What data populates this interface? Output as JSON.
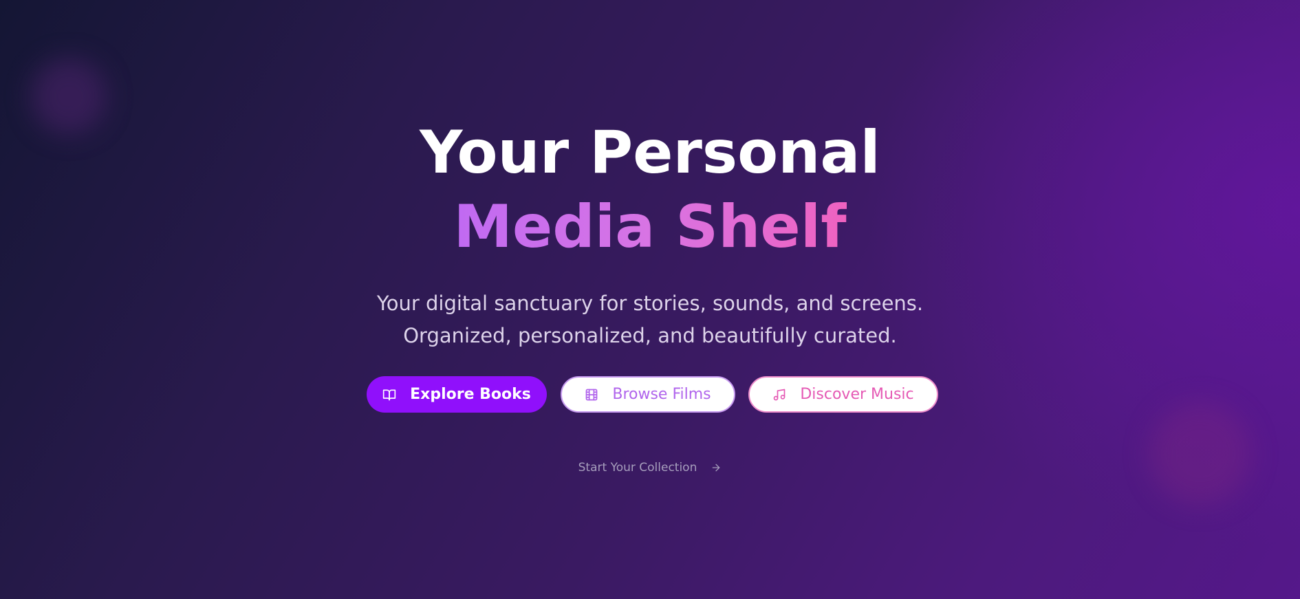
{
  "hero": {
    "title_line1": "Your Personal",
    "title_line2": "Media Shelf",
    "subtitle_line1": "Your digital sanctuary for stories, sounds, and screens.",
    "subtitle_line2": "Organized, personalized, and beautifully curated."
  },
  "buttons": {
    "books": {
      "label": "Explore Books",
      "icon": "book-open-icon"
    },
    "films": {
      "label": "Browse Films",
      "icon": "film-icon"
    },
    "music": {
      "label": "Discover Music",
      "icon": "music-note-icon"
    }
  },
  "cta": {
    "label": "Start Your Collection",
    "icon": "arrow-right-icon"
  },
  "colors": {
    "primary_purple": "#9010fb",
    "film_text": "#b064ec",
    "music_text": "#e559b4",
    "gradient_start": "#c06af2",
    "gradient_end": "#ef62c0"
  }
}
